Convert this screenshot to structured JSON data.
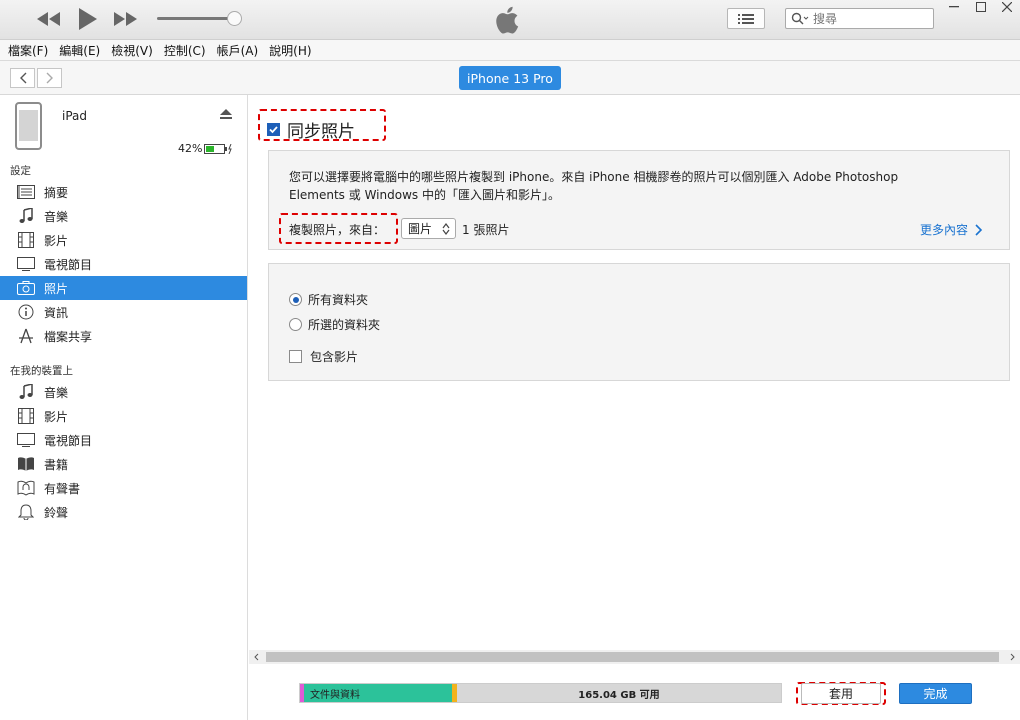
{
  "titlebar": {
    "search_placeholder": "搜尋"
  },
  "menu": [
    "檔案(F)",
    "編輯(E)",
    "檢視(V)",
    "控制(C)",
    "帳戶(A)",
    "說明(H)"
  ],
  "device_pill": "iPhone 13 Pro",
  "device": {
    "name": "iPad",
    "battery": "42%"
  },
  "sidebar": {
    "settings_title": "設定",
    "settings_items": [
      {
        "label": "摘要",
        "icon": "summary-icon"
      },
      {
        "label": "音樂",
        "icon": "music-note-icon"
      },
      {
        "label": "影片",
        "icon": "film-icon"
      },
      {
        "label": "電視節目",
        "icon": "tv-icon"
      },
      {
        "label": "照片",
        "icon": "camera-icon"
      },
      {
        "label": "資訊",
        "icon": "info-icon"
      },
      {
        "label": "檔案共享",
        "icon": "apps-icon"
      }
    ],
    "ondevice_title": "在我的裝置上",
    "ondevice_items": [
      {
        "label": "音樂",
        "icon": "music-note-icon"
      },
      {
        "label": "影片",
        "icon": "film-icon"
      },
      {
        "label": "電視節目",
        "icon": "tv-icon"
      },
      {
        "label": "書籍",
        "icon": "book-icon"
      },
      {
        "label": "有聲書",
        "icon": "audiobook-icon"
      },
      {
        "label": "鈴聲",
        "icon": "bell-icon"
      }
    ]
  },
  "main": {
    "sync_label": "同步照片",
    "description_line1": "您可以選擇要將電腦中的哪些照片複製到 iPhone。來自 iPhone 相機膠卷的照片可以個別匯入 Adobe Photoshop",
    "description_line2": "Elements 或 Windows 中的「匯入圖片和影片」。",
    "copy_from_label": "複製照片，來自：",
    "copy_from_value": "圖片",
    "photo_count": "1 張照片",
    "more_link": "更多內容",
    "option_all": "所有資料夾",
    "option_selected": "所選的資料夾",
    "include_videos": "包含影片"
  },
  "storage": {
    "docs_label": "文件與資料",
    "free_label": "165.04 GB 可用"
  },
  "buttons": {
    "apply": "套用",
    "done": "完成"
  },
  "colors": {
    "accent": "#2d8ae0",
    "docs": "#2cc29a",
    "highlight": "#dd0000"
  }
}
